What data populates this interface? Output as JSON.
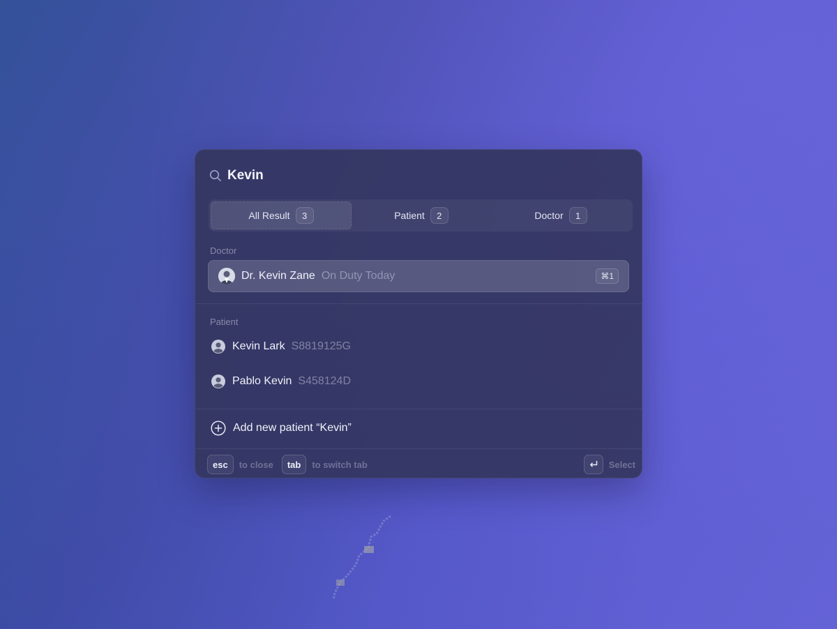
{
  "search": {
    "value": "Kevin"
  },
  "tabs": [
    {
      "label": "All Result",
      "count": "3",
      "active": true
    },
    {
      "label": "Patient",
      "count": "2",
      "active": false
    },
    {
      "label": "Doctor",
      "count": "1",
      "active": false
    }
  ],
  "sections": {
    "doctor_label": "Doctor",
    "patient_label": "Patient"
  },
  "doctor_results": [
    {
      "name": "Dr. Kevin Zane",
      "status": "On Duty Today",
      "shortcut": "⌘1"
    }
  ],
  "patient_results": [
    {
      "name": "Kevin Lark",
      "id": "S8819125G"
    },
    {
      "name": "Pablo Kevin",
      "id": "S458124D"
    }
  ],
  "add_action": {
    "label": "Add new patient “Kevin”"
  },
  "footer": {
    "esc_key": "esc",
    "esc_hint": "to close",
    "tab_key": "tab",
    "tab_hint": "to switch tab",
    "select_hint": "Select"
  },
  "icons": {
    "search": "search-icon",
    "doctor_avatar": "avatar",
    "patient": "user-circle-icon",
    "add": "plus-circle-icon",
    "enter": "enter-icon"
  },
  "colors": {
    "panel_bg": "#343660",
    "text_primary": "#f0f1fa",
    "text_muted": "#a8abc8"
  }
}
